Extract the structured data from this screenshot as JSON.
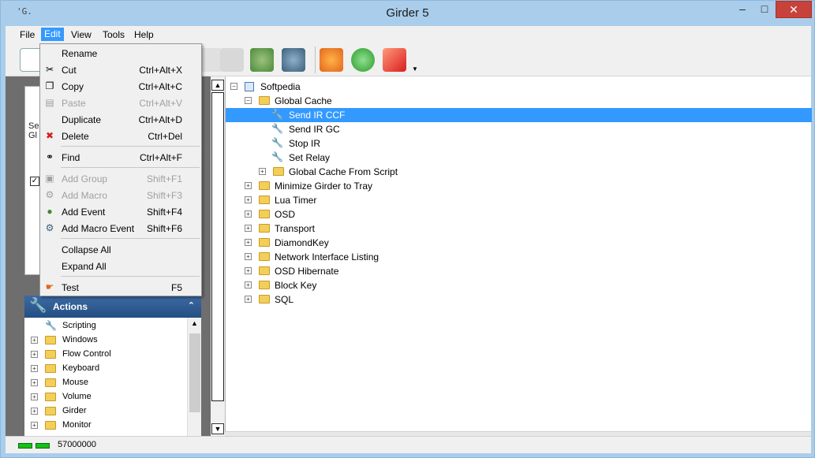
{
  "window": {
    "title": "Girder 5",
    "app_icon": "'G.",
    "minimize": "–",
    "maximize": "□",
    "close": "✕"
  },
  "menubar": [
    {
      "label": "File"
    },
    {
      "label": "Edit"
    },
    {
      "label": "View"
    },
    {
      "label": "Tools"
    },
    {
      "label": "Help"
    }
  ],
  "edit_menu": {
    "items": [
      {
        "label": "Rename",
        "shortcut": "",
        "icon": "",
        "disabled": false
      },
      {
        "label": "Cut",
        "shortcut": "Ctrl+Alt+X",
        "icon": "scissors-icon",
        "disabled": false
      },
      {
        "label": "Copy",
        "shortcut": "Ctrl+Alt+C",
        "icon": "copy-icon",
        "disabled": false
      },
      {
        "label": "Paste",
        "shortcut": "Ctrl+Alt+V",
        "icon": "paste-icon",
        "disabled": true
      },
      {
        "label": "Duplicate",
        "shortcut": "Ctrl+Alt+D",
        "icon": "",
        "disabled": false
      },
      {
        "label": "Delete",
        "shortcut": "Ctrl+Del",
        "icon": "delete-x-icon",
        "disabled": false
      },
      {
        "label": "Find",
        "shortcut": "Ctrl+Alt+F",
        "icon": "binoculars-icon",
        "disabled": false
      },
      {
        "label": "Add Group",
        "shortcut": "Shift+F1",
        "icon": "add-group-icon",
        "disabled": true
      },
      {
        "label": "Add Macro",
        "shortcut": "Shift+F3",
        "icon": "add-macro-icon",
        "disabled": true
      },
      {
        "label": "Add Event",
        "shortcut": "Shift+F4",
        "icon": "add-event-icon",
        "disabled": false
      },
      {
        "label": "Add Macro Event",
        "shortcut": "Shift+F6",
        "icon": "add-macro-event-icon",
        "disabled": false
      },
      {
        "label": "Collapse All",
        "shortcut": "",
        "icon": "",
        "disabled": false
      },
      {
        "label": "Expand All",
        "shortcut": "",
        "icon": "",
        "disabled": false
      },
      {
        "label": "Test",
        "shortcut": "F5",
        "icon": "test-hand-icon",
        "disabled": false
      }
    ]
  },
  "left_panel": {
    "card_line1": "Se",
    "card_line2": "Gl",
    "actions_title": "Actions",
    "actions_items": [
      {
        "label": "Scripting",
        "type": "action"
      },
      {
        "label": "Windows",
        "type": "folder"
      },
      {
        "label": "Flow Control",
        "type": "folder"
      },
      {
        "label": "Keyboard",
        "type": "folder"
      },
      {
        "label": "Mouse",
        "type": "folder"
      },
      {
        "label": "Volume",
        "type": "folder"
      },
      {
        "label": "Girder",
        "type": "folder"
      },
      {
        "label": "Monitor",
        "type": "folder"
      }
    ]
  },
  "tree": {
    "root": "Softpedia",
    "nodes": [
      {
        "label": "Global Cache",
        "level": 1,
        "type": "folder",
        "expanded": true
      },
      {
        "label": "Send IR CCF",
        "level": 2,
        "type": "action",
        "selected": true
      },
      {
        "label": "Send IR GC",
        "level": 2,
        "type": "action"
      },
      {
        "label": "Stop IR",
        "level": 2,
        "type": "action"
      },
      {
        "label": "Set Relay",
        "level": 2,
        "type": "action"
      },
      {
        "label": "Global Cache From Script",
        "level": 2,
        "type": "folder"
      },
      {
        "label": "Minimize Girder to Tray",
        "level": 1,
        "type": "folder"
      },
      {
        "label": "Lua Timer",
        "level": 1,
        "type": "folder"
      },
      {
        "label": "OSD",
        "level": 1,
        "type": "folder"
      },
      {
        "label": "Transport",
        "level": 1,
        "type": "folder"
      },
      {
        "label": "DiamondKey",
        "level": 1,
        "type": "folder"
      },
      {
        "label": "Network Interface Listing",
        "level": 1,
        "type": "folder"
      },
      {
        "label": "OSD Hibernate",
        "level": 1,
        "type": "folder"
      },
      {
        "label": "Block Key",
        "level": 1,
        "type": "folder"
      },
      {
        "label": "SQL",
        "level": 1,
        "type": "folder"
      }
    ]
  },
  "statusbar": {
    "text": "57000000"
  },
  "colors": {
    "title_bg": "#a9cdea",
    "selection": "#3399ff",
    "close_btn": "#c7423a",
    "folder": "#f3cf59",
    "actions_header": "#244f83"
  }
}
